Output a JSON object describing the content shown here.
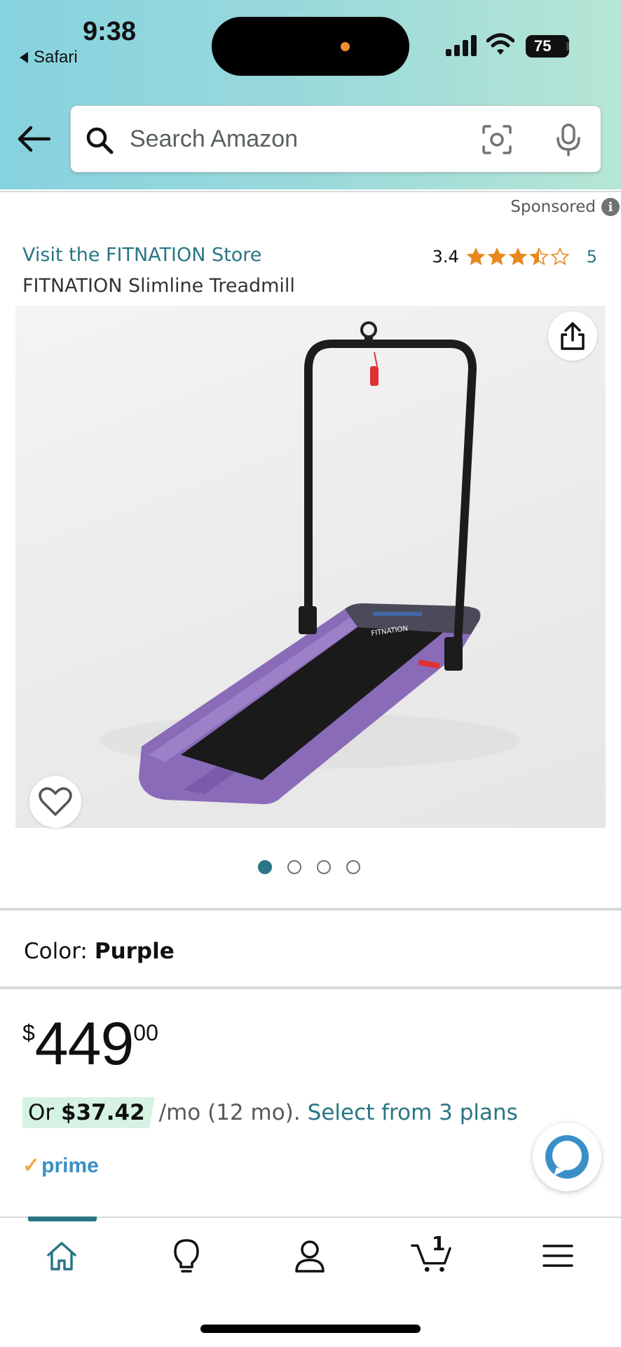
{
  "status_bar": {
    "time": "9:38",
    "back_app": "Safari",
    "battery": "75"
  },
  "search": {
    "placeholder": "Search Amazon"
  },
  "listing": {
    "sponsored_label": "Sponsored",
    "store_link": "Visit the FITNATION Store",
    "product_title": "FITNATION Slimline Treadmill",
    "rating_value": "3.4",
    "rating_stars": 3.4,
    "rating_count": "5"
  },
  "gallery": {
    "image_count": 4,
    "active_index": 0,
    "product_color": "#8a6bb8"
  },
  "variant": {
    "color_label": "Color:",
    "color_value": "Purple"
  },
  "pricing": {
    "currency_symbol": "$",
    "whole": "449",
    "fraction": "00",
    "finance_prefix": "Or",
    "finance_amount": "$37.42",
    "finance_term": "/mo (12 mo).",
    "finance_link": "Select from 3 plans",
    "prime_label": "prime"
  },
  "bottom_nav": {
    "items": [
      "home-icon",
      "bulb-icon",
      "account-icon",
      "cart-icon",
      "menu-icon"
    ],
    "cart_count": "1",
    "active": "home"
  },
  "colors": {
    "link": "#2a7685",
    "star": "#e7891d",
    "finance_pill": "#d6f2e3"
  }
}
